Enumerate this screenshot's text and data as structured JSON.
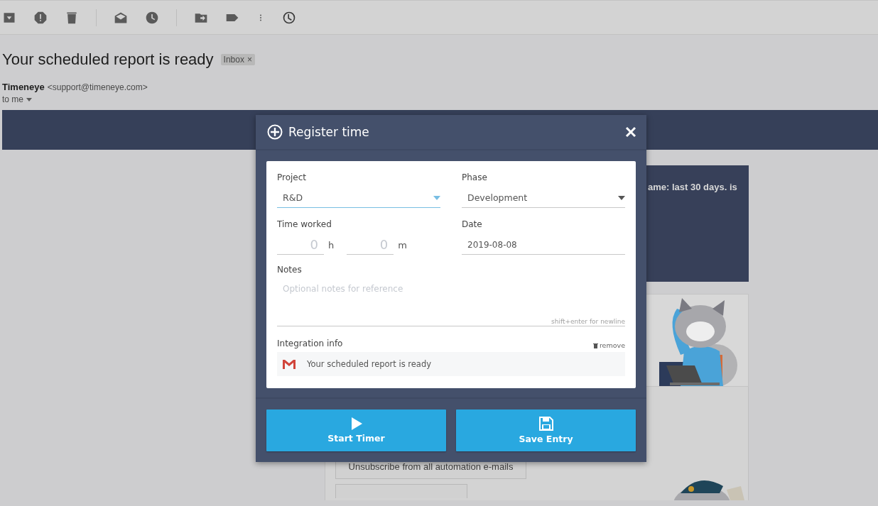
{
  "email": {
    "subject": "Your scheduled report is ready",
    "label": "Inbox",
    "label_remove": "×",
    "sender_name": "Timeneye",
    "sender_email": "<support@timeneye.com>",
    "recipient": "to me"
  },
  "email_body": {
    "banner_text": "ame: last 30 days. is",
    "buttons": [
      "Unsubscribe from all automation e-mails"
    ]
  },
  "dialog": {
    "title": "Register time",
    "project": {
      "label": "Project",
      "value": "R&D",
      "focused": true
    },
    "phase": {
      "label": "Phase",
      "value": "Development",
      "focused": false
    },
    "time_worked": {
      "label": "Time worked",
      "hours_placeholder": "0",
      "hours_unit": "h",
      "minutes_placeholder": "0",
      "minutes_unit": "m"
    },
    "date": {
      "label": "Date",
      "value": "2019-08-08"
    },
    "notes": {
      "label": "Notes",
      "placeholder": "Optional notes for reference",
      "hint": "shift+enter for newline"
    },
    "integration": {
      "label": "Integration info",
      "remove": "remove",
      "item": "Your scheduled report is ready"
    },
    "buttons": [
      {
        "kind": "start",
        "label": "Start Timer"
      },
      {
        "kind": "save",
        "label": "Save Entry"
      }
    ]
  }
}
